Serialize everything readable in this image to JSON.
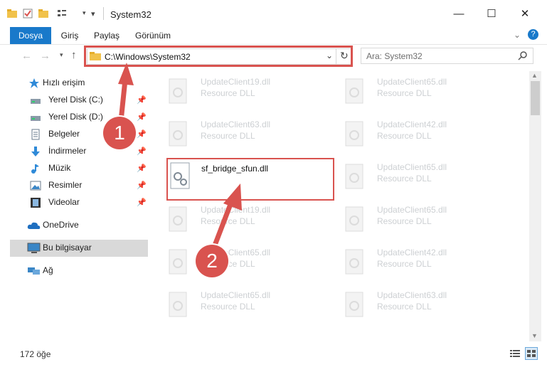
{
  "window": {
    "title": "System32",
    "min": "—",
    "max": "☐",
    "close": "✕"
  },
  "ribbon": {
    "tabs": [
      "Dosya",
      "Giriş",
      "Paylaş",
      "Görünüm"
    ]
  },
  "nav": {
    "address": "C:\\Windows\\System32",
    "search_placeholder": "Ara: System32"
  },
  "sidebar": {
    "items": [
      {
        "label": "Hızlı erişim"
      },
      {
        "label": "Yerel Disk (C:)"
      },
      {
        "label": "Yerel Disk (D:)"
      },
      {
        "label": "Belgeler"
      },
      {
        "label": "İndirmeler"
      },
      {
        "label": "Müzik"
      },
      {
        "label": "Resimler"
      },
      {
        "label": "Videolar"
      },
      {
        "label": "OneDrive"
      },
      {
        "label": "Bu bilgisayar"
      },
      {
        "label": "Ağ"
      }
    ]
  },
  "files": [
    {
      "name": "UpdateClient19.dll",
      "type": "Resource DLL"
    },
    {
      "name": "UpdateClient65.dll",
      "type": "Resource DLL"
    },
    {
      "name": "UpdateClient63.dll",
      "type": "Resource DLL"
    },
    {
      "name": "UpdateClient42.dll",
      "type": "Resource DLL"
    },
    {
      "name": "sf_bridge_sfun.dll",
      "type": ""
    },
    {
      "name": "UpdateClient65.dll",
      "type": "Resource DLL"
    },
    {
      "name": "UpdateClient19.dll",
      "type": "Resource DLL"
    },
    {
      "name": "UpdateClient65.dll",
      "type": "Resource DLL"
    },
    {
      "name": "UpdateClient65.dll",
      "type": "Resource DLL"
    },
    {
      "name": "UpdateClient42.dll",
      "type": "Resource DLL"
    },
    {
      "name": "UpdateClient65.dll",
      "type": "Resource DLL"
    },
    {
      "name": "UpdateClient63.dll",
      "type": "Resource DLL"
    }
  ],
  "status": {
    "count": "172 öğe"
  },
  "markers": {
    "one": "1",
    "two": "2"
  },
  "colors": {
    "accent": "#1979ca",
    "highlight": "#d9534f"
  }
}
